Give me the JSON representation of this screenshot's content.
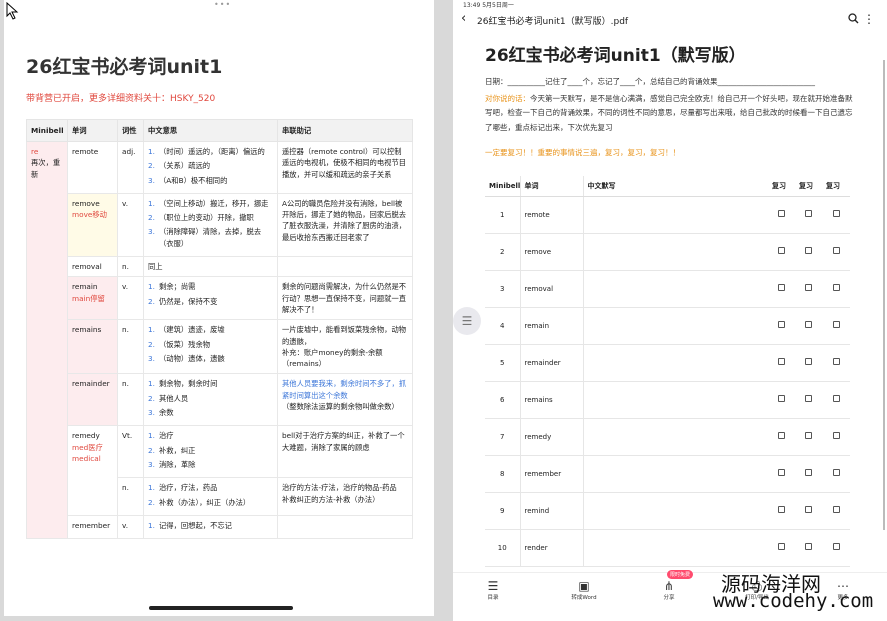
{
  "left": {
    "title": "26红宝书必考词unit1",
    "subtitle": "带背营已开启，更多详细资料关十：HSKY_520",
    "headers": [
      "Minibell",
      "单词",
      "词性",
      "中文意思",
      "串联助记"
    ],
    "rows": [
      {
        "mb": "re",
        "mb2": "再次，重新",
        "word": "remote",
        "pos": "adj.",
        "defs": [
          "（时间）遥远的，（距离）偏远的",
          "（关系）疏远的",
          "（A和B）极不相同的"
        ],
        "memo": "遥控器（remote control）可以控制遥远的电视机，使极不相同的电视节目播放，并可以缓和疏远的亲子关系"
      },
      {
        "word": "remove",
        "word2": "move移动",
        "pos": "v.",
        "defs": [
          "（空间上移动）搬迁，移开，挪走",
          "（职位上的变动）开除，撤职",
          "（消除障碍）清除，去掉，脱去（衣服）"
        ],
        "memo": "A公司的職员危险并没有消除，bell被开除后，挪走了她的物品，回家后脱去了脏衣服洗澡，并清除了厨房的油渍，最后收拾东西搬迁回老家了"
      },
      {
        "word": "removal",
        "pos": "n.",
        "defs": [
          "同上"
        ],
        "memo": ""
      },
      {
        "word": "remain",
        "word2": "main停留",
        "pos": "v.",
        "defs": [
          "剩余；尚需",
          "仍然是，保持不变"
        ],
        "memo": "剩余的问题尚需解决，为什么仍然是不行动？思想一直保持不变，问题就一直解决不了！"
      },
      {
        "word": "remains",
        "pos": "n.",
        "defs": [
          "（建筑）遗迹，废墟",
          "（饭菜）残余物",
          "（动物）遗体，遗骸"
        ],
        "memo": "一片废墟中，能看到饭菜残余物，动物的遗骸，",
        "memo2": "补充：账户money的剩余-余额（remains）"
      },
      {
        "word": "remainder",
        "pos": "n.",
        "defs": [
          "剩余物，剩余时间",
          "其他人员",
          "余数"
        ],
        "memo": "其他人员要我来，剩余时间不多了，抓紧时间算出这个余数",
        "memo2": "（整数除法运算的剩余物叫做余数）"
      },
      {
        "word": "remedy",
        "word2": "med医疗",
        "word3": "medical",
        "pos": "Vt.",
        "defs": [
          "治疗",
          "补救，纠正",
          "消除，革除"
        ],
        "memo": "bell对于治疗方案的纠正，补救了一个大难题，消除了家属的顾虑"
      },
      {
        "pos": "n.",
        "defs": [
          "治疗，疗法，药品",
          "补救（办法），纠正（办法）"
        ],
        "memo": "治疗的方法-疗法，治疗的物品-药品",
        "memo2": "补救纠正的方法-补救（办法）"
      },
      {
        "word": "remember",
        "pos": "v.",
        "defs": [
          "记得，回想起，不忘记"
        ],
        "memo": ""
      }
    ]
  },
  "right": {
    "status_time": "13:49  5月5日周一",
    "doc_title": "26红宝书必考词unit1（默写版）.pdf",
    "title": "26红宝书必考词unit1（默写版）",
    "line_date": "日期：__________记住了____个，忘记了____个，总结自己的背诵效果__________________________",
    "line_intro_label": "对你说的话：",
    "line_intro": "今天第一天默写，是不是信心满满，感觉自己完全欧克！给自己开一个好头吧，现在就开始准备默写吧，检查一下自己的背诵效果，不同的词性不同的意思，尽量都写出来哦，给自己批改的时候看一下自己遗忘了哪些，重点标记出来，下次优先复习",
    "line_motto": "一定要复习！！重要的事情说三遍，复习，复习，复习！！",
    "headers": [
      "Minibell",
      "单词",
      "中文默写",
      "复习",
      "复习",
      "复习"
    ],
    "rows": [
      {
        "n": "1",
        "word": "remote"
      },
      {
        "n": "2",
        "word": "remove"
      },
      {
        "n": "3",
        "word": "removal"
      },
      {
        "n": "4",
        "word": "remain"
      },
      {
        "n": "5",
        "word": "remainder"
      },
      {
        "n": "6",
        "word": "remains"
      },
      {
        "n": "7",
        "word": "remedy"
      },
      {
        "n": "8",
        "word": "remember"
      },
      {
        "n": "9",
        "word": "remind"
      },
      {
        "n": "10",
        "word": "render"
      }
    ],
    "bottom": [
      "目录",
      "转成Word",
      "分享",
      "打印/导出",
      "更多"
    ],
    "badge": "限时免费"
  },
  "watermark": {
    "line1": "源码海洋网",
    "line2": "www.codehy.com"
  }
}
